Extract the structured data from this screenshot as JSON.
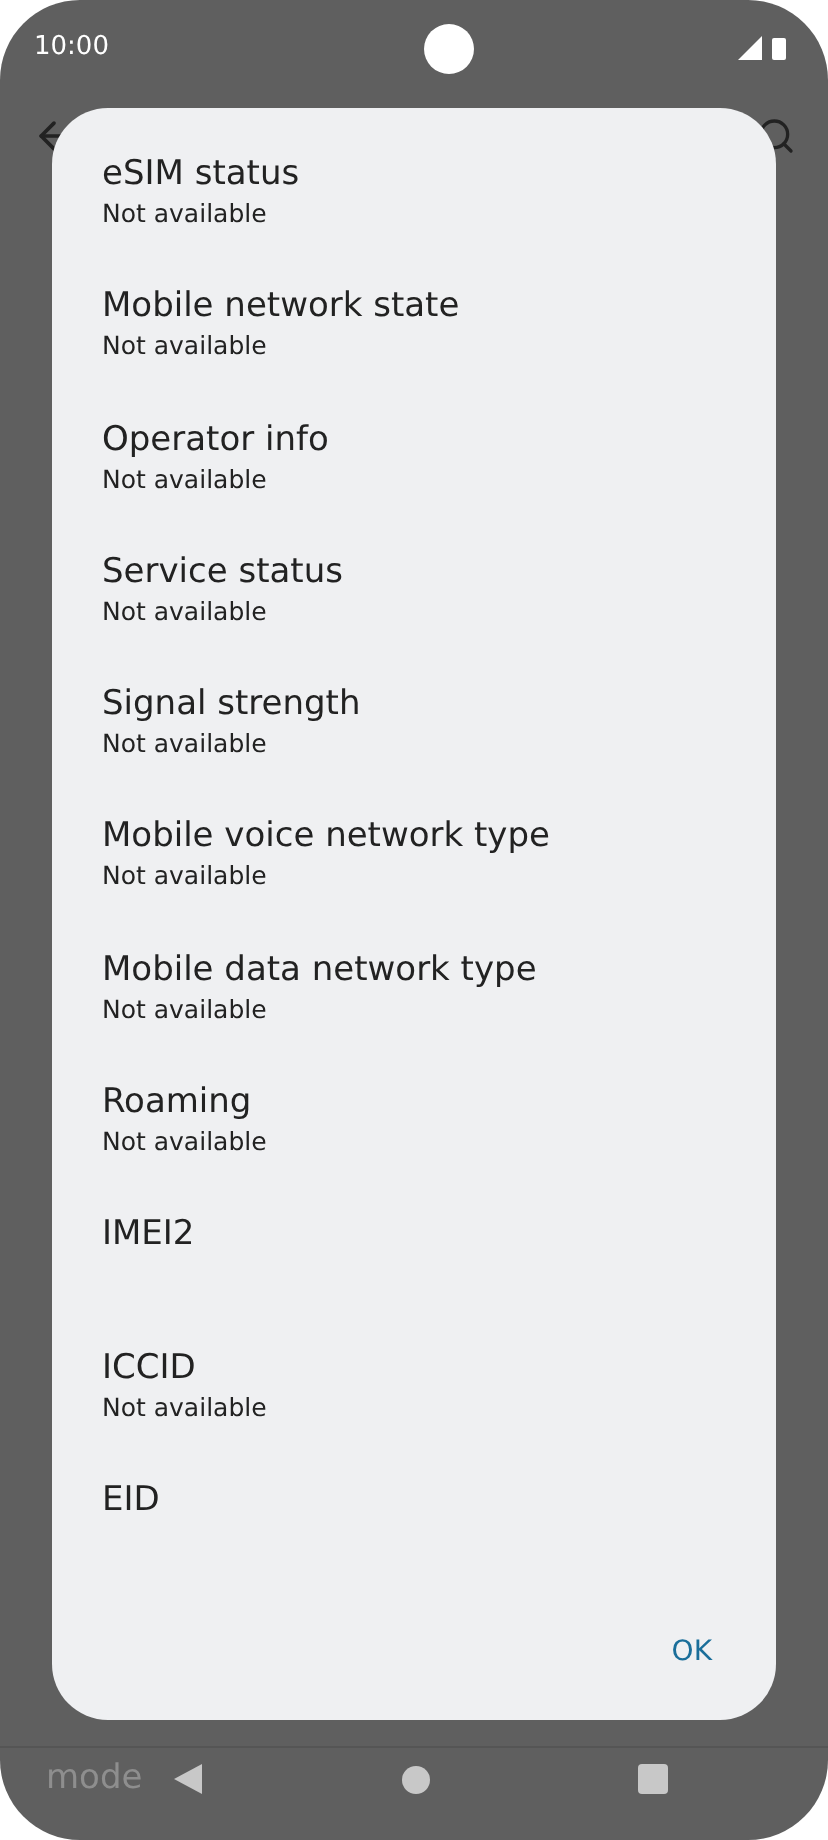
{
  "status_bar": {
    "time": "10:00"
  },
  "dialog": {
    "items": [
      {
        "label": "eSIM status",
        "value": "Not available"
      },
      {
        "label": "Mobile network state",
        "value": "Not available"
      },
      {
        "label": "Operator info",
        "value": "Not available"
      },
      {
        "label": "Service status",
        "value": "Not available"
      },
      {
        "label": "Signal strength",
        "value": "Not available"
      },
      {
        "label": "Mobile voice network type",
        "value": "Not available"
      },
      {
        "label": "Mobile data network type",
        "value": "Not available"
      },
      {
        "label": "Roaming",
        "value": "Not available"
      },
      {
        "label": "IMEI2"
      },
      {
        "label": "ICCID",
        "value": "Not available"
      },
      {
        "label": "EID"
      }
    ],
    "button": "OK"
  },
  "background_text": "mode"
}
